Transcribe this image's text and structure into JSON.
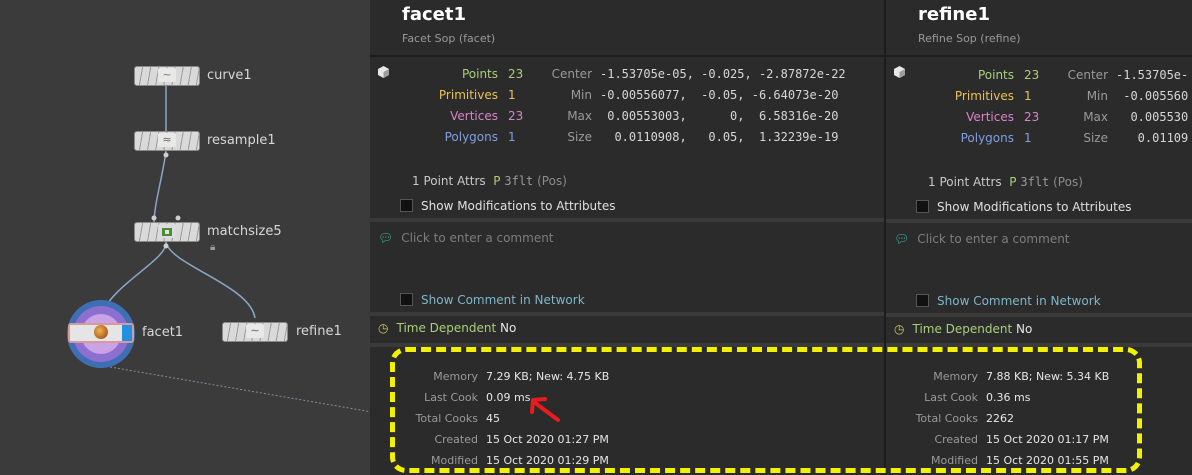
{
  "network": {
    "nodes": [
      {
        "name": "curve1"
      },
      {
        "name": "resample1"
      },
      {
        "name": "matchsize5"
      },
      {
        "name": "facet1"
      },
      {
        "name": "refine1"
      }
    ]
  },
  "panels": [
    {
      "title": "facet1",
      "subtitle": "Facet Sop (facet)",
      "points_label": "Points",
      "points_value": "23",
      "prims_label": "Primitives",
      "prims_value": "1",
      "verts_label": "Vertices",
      "verts_value": "23",
      "polys_label": "Polygons",
      "polys_value": "1",
      "center_label": "Center",
      "center_value": "-1.53705e-05, -0.025, -2.87872e-22",
      "min_label": "Min",
      "min_value": "-0.00556077,  -0.05, -6.64073e-20",
      "max_label": "Max",
      "max_value": " 0.00553003,      0,  6.58316e-20",
      "size_label": "Size",
      "size_value": "  0.0110908,   0.05,  1.32239e-19",
      "attrs_count": "1 Point Attrs",
      "attrs_p": "P",
      "attrs_type": "3flt",
      "attrs_name": "(Pos)",
      "show_mods": "Show Modifications to Attributes",
      "comment_placeholder": "Click to enter a comment",
      "show_comment": "Show Comment in Network",
      "time_dep_label": "Time Dependent",
      "time_dep_value": "No",
      "memory_label": "Memory",
      "memory_value": "7.29 KB; New: 4.75 KB",
      "lastcook_label": "Last Cook",
      "lastcook_value": "0.09 ms",
      "totalcooks_label": "Total Cooks",
      "totalcooks_value": "45",
      "created_label": "Created",
      "created_value": "15 Oct 2020 01:27 PM",
      "modified_label": "Modified",
      "modified_value": "15 Oct 2020 01:29 PM"
    },
    {
      "title": "refine1",
      "subtitle": "Refine Sop (refine)",
      "points_label": "Points",
      "points_value": "23",
      "prims_label": "Primitives",
      "prims_value": "1",
      "verts_label": "Vertices",
      "verts_value": "23",
      "polys_label": "Polygons",
      "polys_value": "1",
      "center_label": "Center",
      "center_value": "-1.53705e-",
      "min_label": "Min",
      "min_value": " -0.005560",
      "max_label": "Max",
      "max_value": "  0.005530",
      "size_label": "Size",
      "size_value": "   0.01109",
      "attrs_count": "1 Point Attrs",
      "attrs_p": "P",
      "attrs_type": "3flt",
      "attrs_name": "(Pos)",
      "show_mods": "Show Modifications to Attributes",
      "comment_placeholder": "Click to enter a comment",
      "show_comment": "Show Comment in Network",
      "time_dep_label": "Time Dependent",
      "time_dep_value": "No",
      "memory_label": "Memory",
      "memory_value": "7.88 KB; New: 5.34 KB",
      "lastcook_label": "Last Cook",
      "lastcook_value": "0.36 ms",
      "totalcooks_label": "Total Cooks",
      "totalcooks_value": "2262",
      "created_label": "Created",
      "created_value": "15 Oct 2020 01:17 PM",
      "modified_label": "Modified",
      "modified_value": "15 Oct 2020 01:55 PM"
    }
  ],
  "colors": {
    "highlight": "#f2f200",
    "arrow": "#e81c1c",
    "points": "#a9cf7a",
    "primitives": "#e8c15a",
    "vertices": "#d884c9",
    "polygons": "#7f9fe0"
  }
}
